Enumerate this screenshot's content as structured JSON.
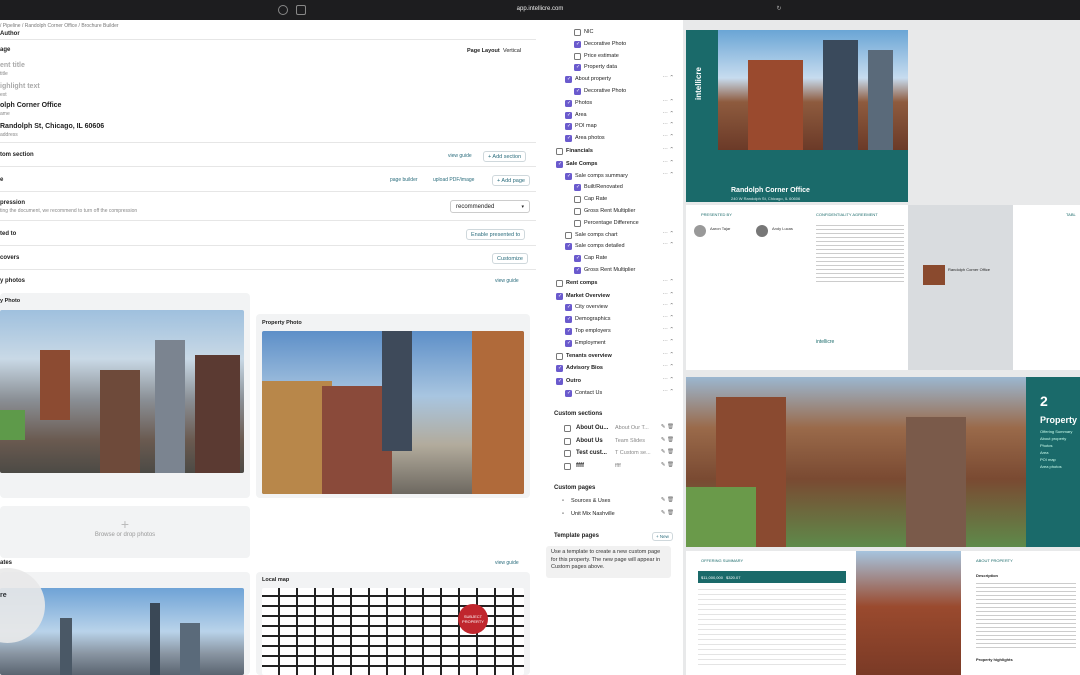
{
  "browser": {
    "url": "app.intellicre.com"
  },
  "breadcrumb": "/ Pipeline  /  Randolph Corner Office  /  Brochure Builder",
  "header": {
    "author": "Author",
    "page": "age",
    "page_layout_label": "Page Layout",
    "page_layout_value": "Vertical"
  },
  "fields": {
    "title_ph": "ent title",
    "title_sub": "title",
    "highlight_ph": "ighlight text",
    "highlight_sub": "ext",
    "name": "olph Corner Office",
    "name_sub": "ame",
    "address": "Randolph St, Chicago, IL 60606",
    "address_sub": "address"
  },
  "sections": {
    "custom_section": "tom section",
    "view_guide": "view guide",
    "add_section": "+ Add section",
    "page": "e",
    "page_builder": "page builder",
    "upload_pdf": "upload PDF/image",
    "add_page": "+ Add page",
    "compression": "pression",
    "compression_desc": "ting the document, we recommend to turn off the compression",
    "compression_value": "recommended",
    "presented_to": "ted to",
    "enable_presented_to": "Enable presented to",
    "covers": "covers",
    "customize": "Customize",
    "photos_label": "y photos",
    "photos_view_guide": "view guide",
    "property_photo_1": "y Photo",
    "property_photo_2": "Property Photo",
    "browse": "Browse or drop photos",
    "bottom_label": "ates",
    "bottom_view_guide": "view guide",
    "local_map": "Local map",
    "subject_property": "SUBJECT PROPERTY",
    "bubble": "re"
  },
  "tree": [
    {
      "label": "NIC",
      "checked": false,
      "indent": 2
    },
    {
      "label": "Decorative Photo",
      "checked": true,
      "indent": 2
    },
    {
      "label": "Price estimate",
      "checked": false,
      "indent": 2
    },
    {
      "label": "Property data",
      "checked": true,
      "indent": 2
    },
    {
      "label": "About property",
      "checked": true,
      "indent": 1
    },
    {
      "label": "Decorative Photo",
      "checked": true,
      "indent": 2
    },
    {
      "label": "Photos",
      "checked": true,
      "indent": 1
    },
    {
      "label": "Area",
      "checked": true,
      "indent": 1
    },
    {
      "label": "POI map",
      "checked": true,
      "indent": 1
    },
    {
      "label": "Area photos",
      "checked": true,
      "indent": 1
    },
    {
      "label": "Financials",
      "checked": false,
      "indent": 0,
      "bold": true
    },
    {
      "label": "Sale Comps",
      "checked": true,
      "indent": 0,
      "bold": true
    },
    {
      "label": "Sale comps summary",
      "checked": true,
      "indent": 1
    },
    {
      "label": "Built/Renovated",
      "checked": true,
      "indent": 2
    },
    {
      "label": "Cap Rate",
      "checked": false,
      "indent": 2
    },
    {
      "label": "Gross Rent Multiplier",
      "checked": false,
      "indent": 2
    },
    {
      "label": "Percentage Difference",
      "checked": false,
      "indent": 2
    },
    {
      "label": "Sale comps chart",
      "checked": false,
      "indent": 1
    },
    {
      "label": "Sale comps detailed",
      "checked": true,
      "indent": 1
    },
    {
      "label": "Cap Rate",
      "checked": true,
      "indent": 2
    },
    {
      "label": "Gross Rent Multiplier",
      "checked": true,
      "indent": 2
    },
    {
      "label": "Rent comps",
      "checked": false,
      "indent": 0,
      "bold": true
    },
    {
      "label": "Market Overview",
      "checked": true,
      "indent": 0,
      "bold": true
    },
    {
      "label": "City overview",
      "checked": true,
      "indent": 1
    },
    {
      "label": "Demographics",
      "checked": true,
      "indent": 1
    },
    {
      "label": "Top employers",
      "checked": true,
      "indent": 1
    },
    {
      "label": "Employment",
      "checked": true,
      "indent": 1
    },
    {
      "label": "Tenants overview",
      "checked": false,
      "indent": 0,
      "bold": true
    },
    {
      "label": "Advisory Bios",
      "checked": true,
      "indent": 0,
      "bold": true
    },
    {
      "label": "Outro",
      "checked": true,
      "indent": 0,
      "bold": true
    },
    {
      "label": "Contact Us",
      "checked": true,
      "indent": 1
    }
  ],
  "custom_sections": {
    "heading": "Custom sections",
    "items": [
      {
        "name": "About Ou...",
        "detail": "About Our T..."
      },
      {
        "name": "About Us",
        "detail": "Team Slides"
      },
      {
        "name": "Test cust...",
        "detail": "T Custom se..."
      },
      {
        "name": "ffff",
        "detail": "ffff"
      }
    ]
  },
  "custom_pages": {
    "heading": "Custom pages",
    "items": [
      "Sources & Uses",
      "Unit Mix Nashville"
    ]
  },
  "template_pages": {
    "heading": "Template pages",
    "new": "+ New",
    "tooltip": "Use a template to create a new custom page for this property. The new page will appear in Custom pages above."
  },
  "preview": {
    "brand": "intellicre",
    "cover_title": "Randolph Corner Office",
    "cover_addr": "240 W Randolph St, Chicago, IL 60606",
    "presented_by": "PRESENTED BY",
    "confidentiality": "CONFIDENTIALITY AGREEMENT",
    "table": "TABL",
    "agent1": "Aaron Tajar",
    "agent2": "Andy Lucas",
    "map_label": "Randolph Corner Office",
    "section_num": "2",
    "section_title": "Property",
    "section_items": [
      "Offering Summary",
      "About property",
      "Photos",
      "Area",
      "POI map",
      "Area photos"
    ],
    "offering": "OFFERING SUMMARY",
    "price1": "$11,000,000",
    "price2": "$320.07",
    "about": "ABOUT PROPERTY",
    "description": "Description",
    "highlights": "Property highlights"
  }
}
